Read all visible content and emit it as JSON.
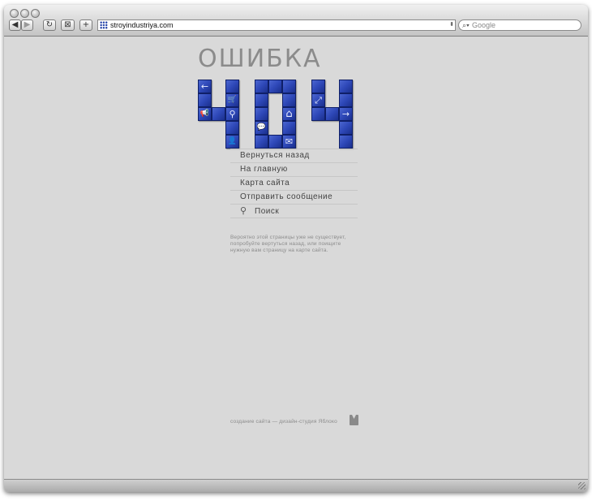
{
  "browser": {
    "url": "stroyindustriya.com",
    "search_placeholder": "Google",
    "buttons": {
      "back": "◀",
      "forward": "▶",
      "reload": "↻",
      "bookmarks": "⊠",
      "add": "+"
    }
  },
  "page": {
    "heading": "ОШИБКА",
    "error_code": "404",
    "menu": [
      {
        "label": "Вернуться назад"
      },
      {
        "label": "На главную"
      },
      {
        "label": "Карта сайта"
      },
      {
        "label": "Отправить сообщение"
      },
      {
        "label": "Поиск",
        "icon": "search-icon"
      }
    ],
    "note": "Вероятно этой страницы уже не существует, попробуйте вертуться назад, или поищите нужную вам страницу на карте сайта.",
    "footer_text": "создание сайта — дизайн-студия Яблоко",
    "tile_icons": {
      "back": "←",
      "cart": "🛒",
      "ads": "📢",
      "search": "⚲",
      "user": "👤",
      "chat": "💬",
      "home": "⌂",
      "mail": "✉",
      "fullscreen": "⤢",
      "forward": "→"
    },
    "colors": {
      "tile": "#2e48b8",
      "background": "#d9d9d9",
      "heading": "#8b8b8b"
    }
  }
}
